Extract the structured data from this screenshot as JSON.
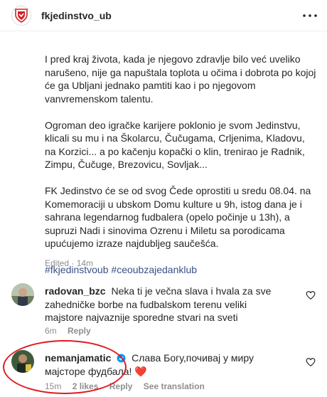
{
  "post": {
    "username": "fkjedinstvo_ub",
    "paragraphs": [
      "I pred kraj života, kada je njegovo zdravlje bilo već uveliko narušeno, nije ga napuštala toplota u očima i dobrota po kojoj će ga Ubljani jednako pamtiti kao i po njegovom vanvremenskom talentu.",
      "Ogroman deo igračke karijere poklonio je svom Jedinstvu, klicali su mu i na Školarcu, Čučugama, Crljenima, Kladovu, na Korzici... a po kačenju kopački o klin, trenirao je Radnik, Zimpu, Čučuge, Brezovicu, Sovljak...",
      "FK Jedinstvo će se od svog Čede oprostiti u sredu 08.04. na Komemoraciji u ubskom Domu kulture u 9h, istog dana je i sahrana legendarnog fudbalera (opelo počinje u 13h), a supruzi Nadi i sinovima Ozrenu i Miletu sa porodicama upućujemo izraze najdubljeg saučešća."
    ],
    "hashtags": [
      "#fkjedinstvoub",
      "#ceoubzajedanklub"
    ],
    "meta": "Edited · 14m"
  },
  "comments": [
    {
      "username": "radovan_bzc",
      "text": "Neka ti je večna slava i hvala za sve zahedničke borbe na fudbalskom terenu veliki majstore najvaznije sporedne stvari na sveti",
      "time": "6m",
      "reply": "Reply"
    },
    {
      "username": "nemanjamatic",
      "text": "Слава Богу,почивај у миру мајсторе фудбала! ❤️",
      "time": "15m",
      "likes": "2 likes",
      "reply": "Reply",
      "translate": "See translation"
    }
  ],
  "colors": {
    "hashtag": "#385185",
    "highlight_circle": "#e01b24",
    "verified": "#0095f6"
  }
}
